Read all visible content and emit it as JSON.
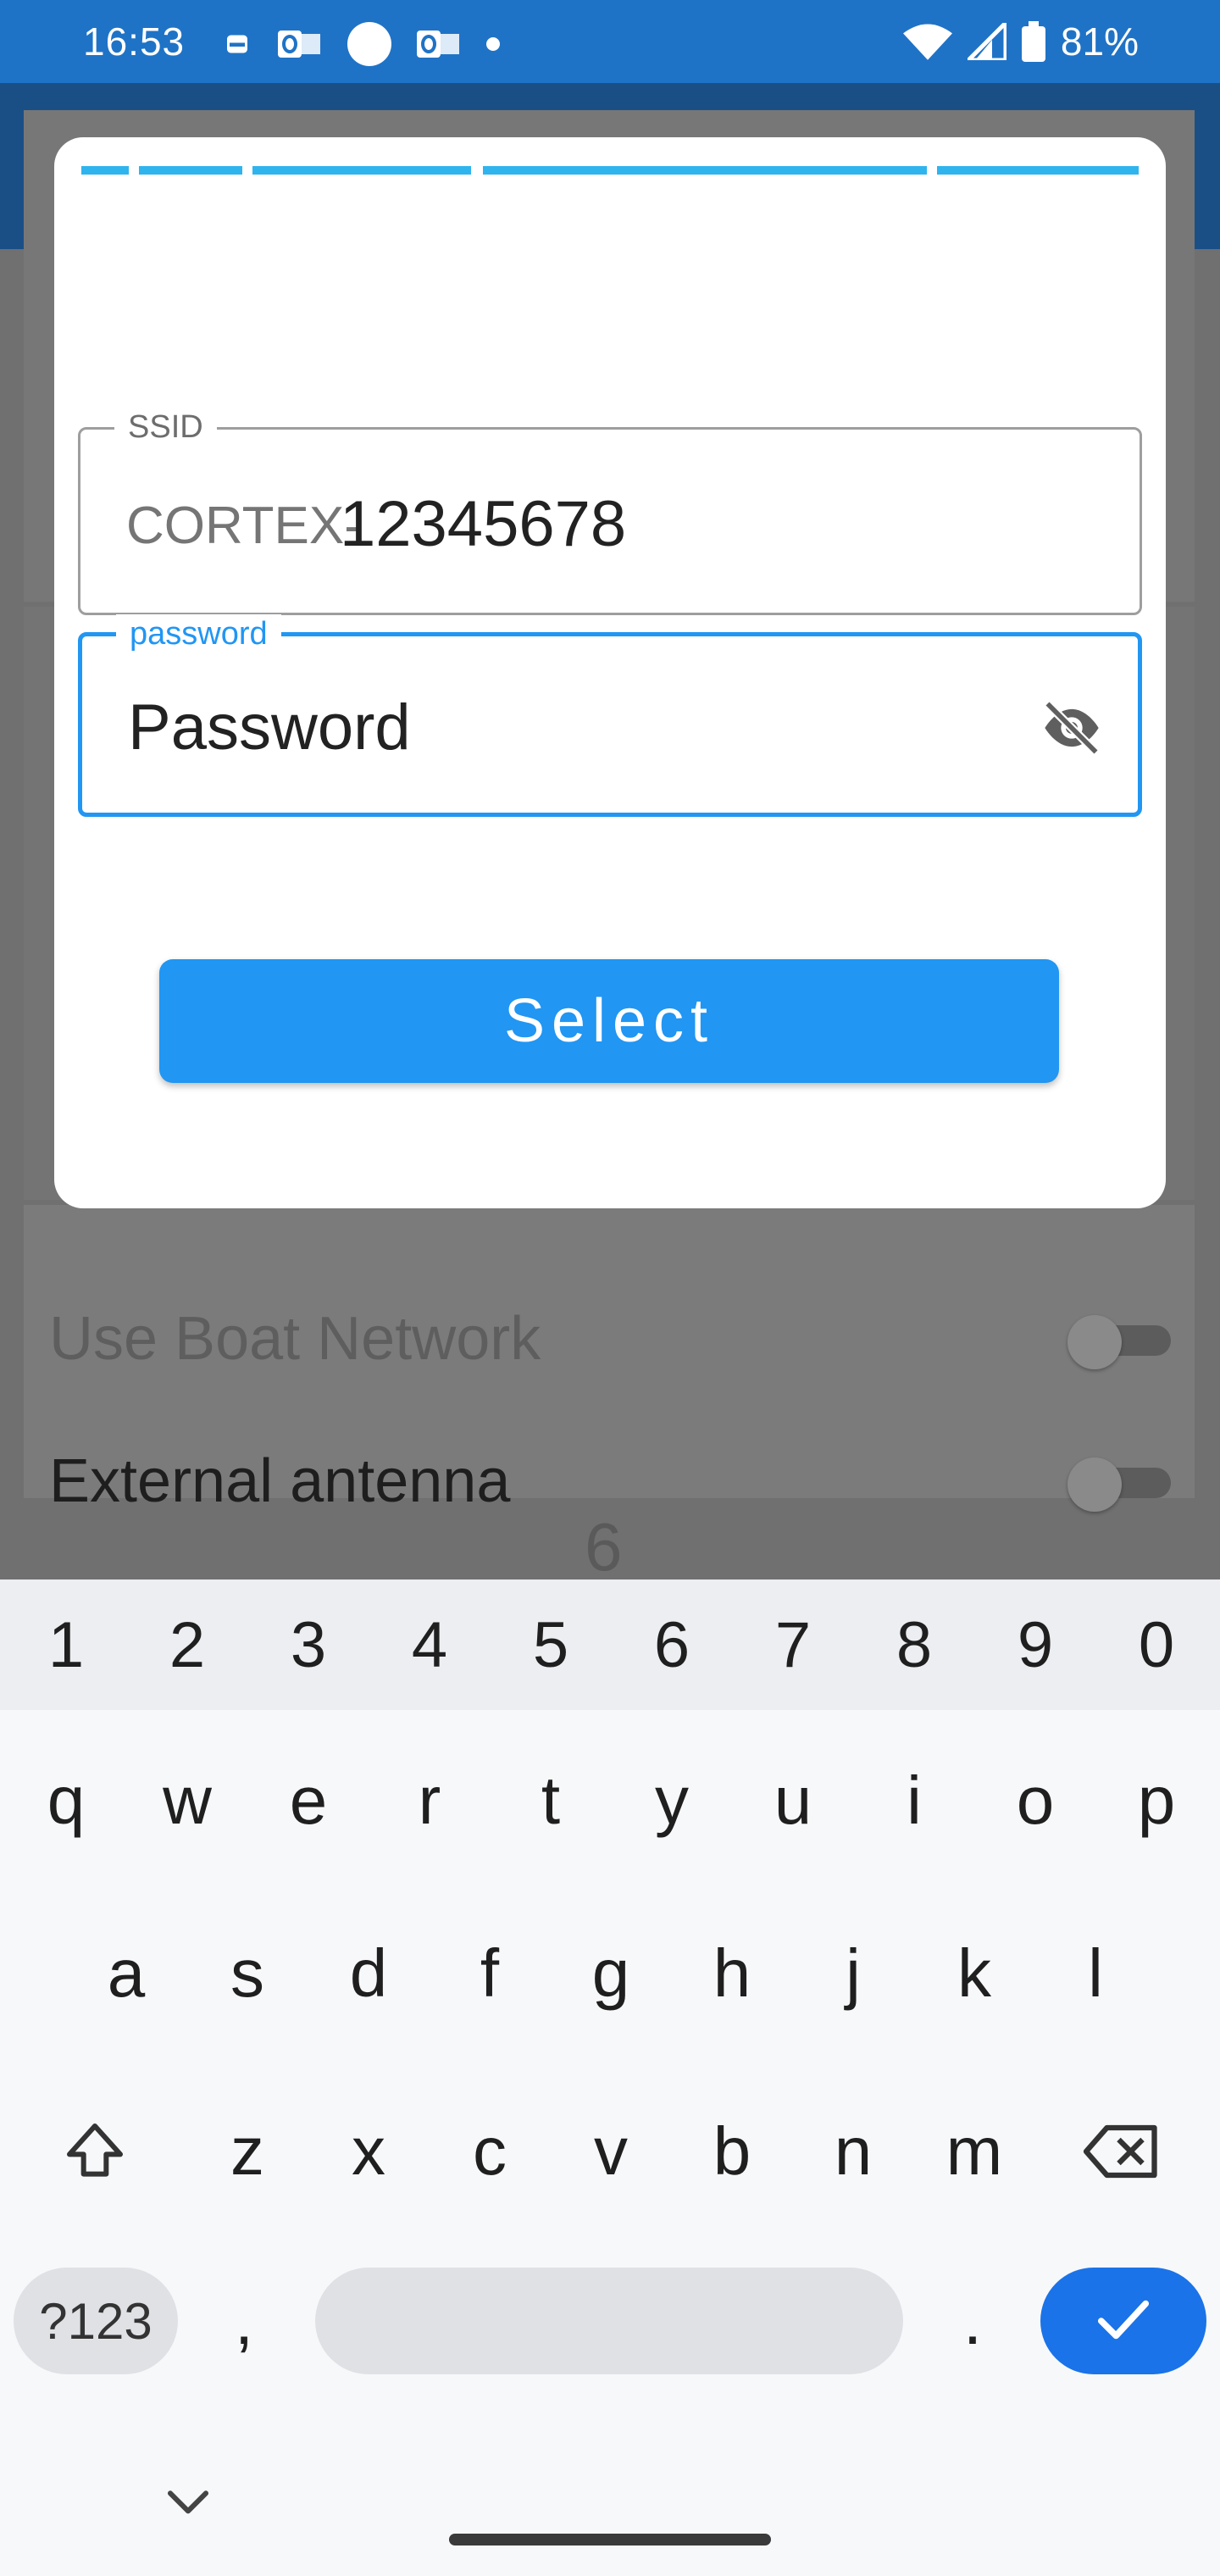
{
  "status_bar": {
    "time": "16:53",
    "battery": "81%",
    "icons_left": [
      "sim-card-icon",
      "outlook-icon",
      "circle-icon",
      "outlook-icon",
      "dot-icon"
    ],
    "icons_right": [
      "wifi-icon",
      "signal-icon",
      "battery-icon"
    ]
  },
  "dialog": {
    "progress_segments": 5,
    "ssid": {
      "label": "SSID",
      "prefix": "CORTEX-",
      "value": "12345678"
    },
    "password": {
      "label": "password",
      "value": "Password",
      "toggle_icon": "visibility-off-icon"
    },
    "select_button": "Select",
    "colors": {
      "accent": "#2196f3",
      "progress": "#2fb4ee"
    }
  },
  "background": {
    "settings": [
      {
        "label": "Use Boat Network",
        "enabled": false
      },
      {
        "label": "External antenna",
        "enabled": false
      }
    ],
    "digit": "6"
  },
  "keyboard": {
    "numbers": [
      "1",
      "2",
      "3",
      "4",
      "5",
      "6",
      "7",
      "8",
      "9",
      "0"
    ],
    "row1": [
      "q",
      "w",
      "e",
      "r",
      "t",
      "y",
      "u",
      "i",
      "o",
      "p"
    ],
    "row2": [
      "a",
      "s",
      "d",
      "f",
      "g",
      "h",
      "j",
      "k",
      "l"
    ],
    "row3": [
      "z",
      "x",
      "c",
      "v",
      "b",
      "n",
      "m"
    ],
    "symbols_key": "?123",
    "comma": ",",
    "period": ".",
    "shift_icon": "shift-icon",
    "backspace_icon": "backspace-icon",
    "enter_icon": "check-icon",
    "hide_icon": "chevron-down-icon"
  }
}
